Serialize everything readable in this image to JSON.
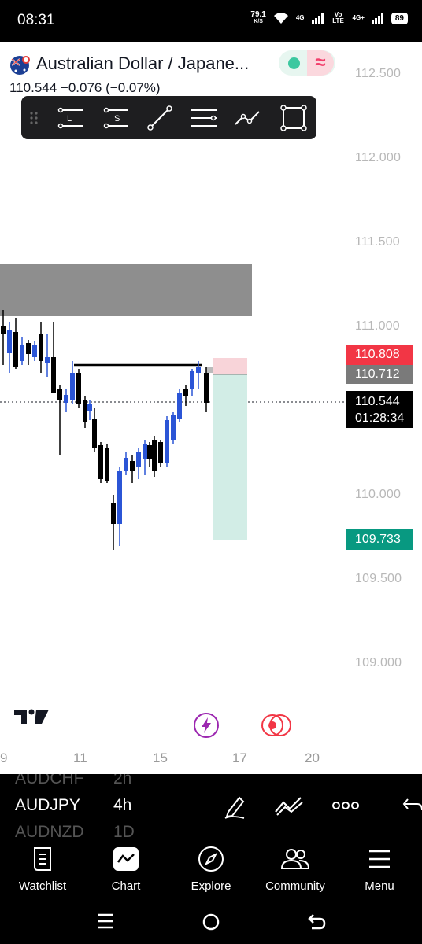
{
  "status_bar": {
    "time": "08:31",
    "net_speed_value": "79.1",
    "net_speed_unit": "K/S",
    "sig1_label": "4G",
    "volte_label": "Vo LTE",
    "sig2_label": "4G+",
    "battery": "89"
  },
  "chart": {
    "symbol_title": "Australian Dollar / Japane...",
    "quote": "110.544  −0.076 (−0.07%)",
    "price_axis": [
      "112.500",
      "112.000",
      "111.500",
      "111.000",
      "110.000",
      "109.500",
      "109.000"
    ],
    "tags": {
      "stop": "110.808",
      "entry": "110.712",
      "last": "110.544",
      "countdown": "01:28:34",
      "target": "109.733"
    },
    "date_axis": [
      "9",
      "11",
      "15",
      "17",
      "20"
    ],
    "colors": {
      "bull": "#2b55d6",
      "bear": "#000000",
      "stop_tag": "#f23645",
      "entry_tag": "#7a7a7a",
      "target_tag": "#089981",
      "zone": "#8e8e8e"
    },
    "toolbar_icons": [
      "horizontal-line-L-icon",
      "horizontal-line-S-icon",
      "trend-line-icon",
      "parallel-lines-icon",
      "path-icon",
      "rectangle-icon"
    ]
  },
  "symbol_bar": {
    "prev_symbol": "AUDCHF",
    "prev_interval": "2h",
    "symbol": "AUDJPY",
    "interval": "4h",
    "next_symbol": "AUDNZD",
    "next_interval": "1D"
  },
  "bottom_nav": {
    "watchlist": "Watchlist",
    "chart": "Chart",
    "explore": "Explore",
    "community": "Community",
    "menu": "Menu"
  }
}
